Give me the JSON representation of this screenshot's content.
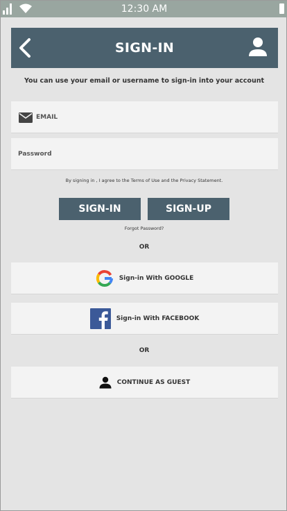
{
  "status_bar": {
    "time": "12:30 AM"
  },
  "header": {
    "title": "SIGN-IN"
  },
  "subtitle": "You can use your email or username to sign-in into your account",
  "email_field": {
    "placeholder": "EMAIL"
  },
  "password_field": {
    "placeholder": "Password"
  },
  "terms_text": "By signing in , I agree to the Terms of Use and the Privacy Statement.",
  "buttons": {
    "signin": "SIGN-IN",
    "signup": "SIGN-UP"
  },
  "forgot_password": "Forgot Password?",
  "or_text": "OR",
  "social": {
    "google": "Sign-in With GOOGLE",
    "facebook": "Sign-in With FACEBOOK",
    "guest": "CONTINUE AS GUEST"
  },
  "colors": {
    "header_bg": "#4b616e",
    "status_bar_bg": "#99a6a0",
    "page_bg": "#e4e4e4",
    "facebook_blue": "#3b5998"
  },
  "icons": {
    "signal": "signal-bars-icon",
    "wifi": "wifi-icon",
    "battery": "battery-icon",
    "back": "chevron-left-icon",
    "profile": "user-icon",
    "mail": "mail-icon",
    "google": "google-logo-icon",
    "facebook": "facebook-logo-icon",
    "guest": "user-icon"
  }
}
